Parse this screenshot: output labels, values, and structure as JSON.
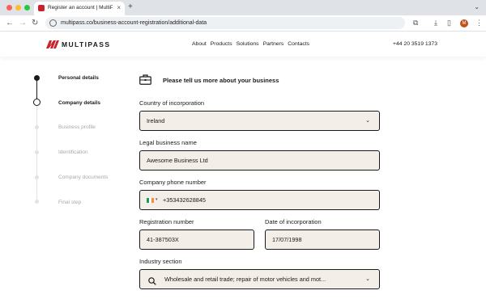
{
  "browser": {
    "tab_title": "Register an account | MultiPa",
    "tab_close": "×",
    "new_tab": "+",
    "url": "multipass.co/business-account-registration/additional-data",
    "profile_initial": "M"
  },
  "header": {
    "logo_text": "MULTIPASS",
    "brand_color": "#c8232c",
    "nav": [
      "About",
      "Products",
      "Solutions",
      "Partners",
      "Contacts"
    ],
    "phone": "+44 20 3519 1373"
  },
  "steps": [
    {
      "label": "Personal details",
      "state": "done"
    },
    {
      "label": "Company details",
      "state": "active"
    },
    {
      "label": "Business profile",
      "state": "upcoming"
    },
    {
      "label": "Identification",
      "state": "upcoming"
    },
    {
      "label": "Company documents",
      "state": "upcoming"
    },
    {
      "label": "Final step",
      "state": "upcoming"
    }
  ],
  "form": {
    "heading": "Please tell us more about your business",
    "country": {
      "label": "Country of incorporation",
      "value": "Ireland"
    },
    "legal_name": {
      "label": "Legal business name",
      "value": "Awesome Business Ltd"
    },
    "phone": {
      "label": "Company phone number",
      "value": "+353432628845",
      "flag_colors": [
        "#169b62",
        "#ffffff",
        "#ff883e"
      ]
    },
    "registration": {
      "label": "Registration number",
      "value": "41-387503X"
    },
    "incorporation_date": {
      "label": "Date of incorporation",
      "value": "17/07/1998"
    },
    "industry": {
      "label": "Industry section",
      "value": "Wholesale and retail trade; repair of motor vehicles and mot..."
    }
  },
  "colors": {
    "field_bg": "#f3efe8",
    "field_border": "#1a1a1a"
  }
}
